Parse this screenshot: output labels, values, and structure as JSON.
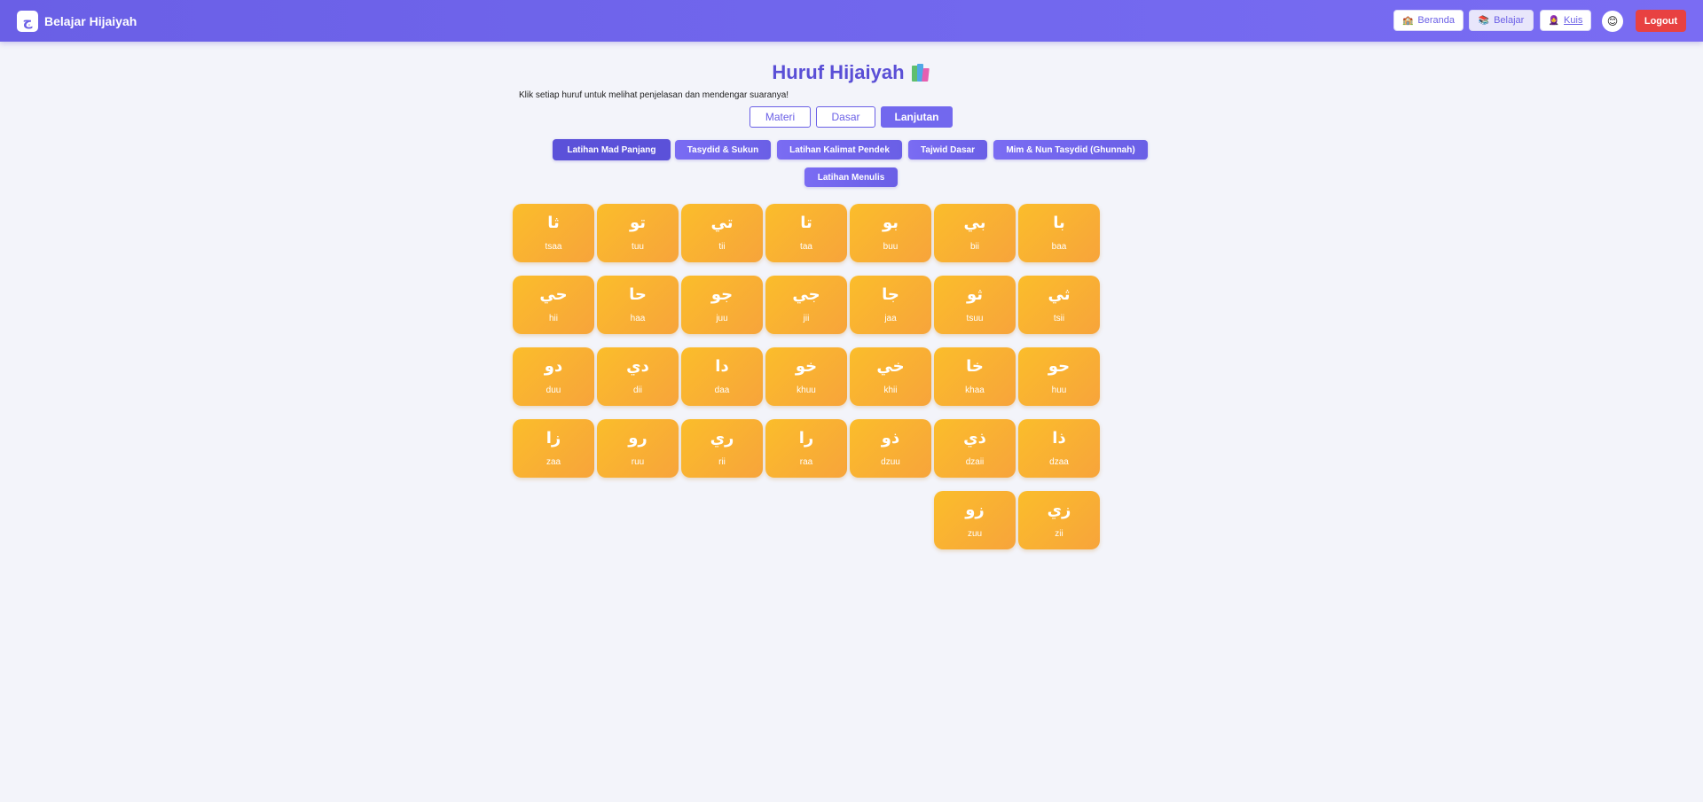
{
  "header": {
    "logo_char": "ج",
    "title": "Belajar Hijaiyah",
    "nav": [
      {
        "icon": "🏫",
        "label": "Beranda"
      },
      {
        "icon": "📚",
        "label": "Belajar"
      },
      {
        "icon": "🧕",
        "label": "Kuis"
      }
    ],
    "avatar": "😊",
    "logout": "Logout"
  },
  "main": {
    "title": "Huruf Hijaiyah",
    "subtitle": "Klik setiap huruf untuk melihat penjelasan dan mendengar suaranya!",
    "tabs": [
      "Materi",
      "Dasar",
      "Lanjutan"
    ],
    "active_tab": "Lanjutan",
    "sub_buttons": [
      "Latihan Mad Panjang",
      "Tasydid & Sukun",
      "Latihan Kalimat Pendek",
      "Tajwid Dasar",
      "Mim & Nun Tasydid (Ghunnah)",
      "Latihan Menulis"
    ],
    "selected_sub": "Latihan Mad Panjang",
    "cards": [
      {
        "ar": "ثا",
        "lat": "tsaa"
      },
      {
        "ar": "تو",
        "lat": "tuu"
      },
      {
        "ar": "تي",
        "lat": "tii"
      },
      {
        "ar": "تا",
        "lat": "taa"
      },
      {
        "ar": "بو",
        "lat": "buu"
      },
      {
        "ar": "بي",
        "lat": "bii"
      },
      {
        "ar": "با",
        "lat": "baa"
      },
      {
        "ar": "حي",
        "lat": "hii"
      },
      {
        "ar": "حا",
        "lat": "haa"
      },
      {
        "ar": "جو",
        "lat": "juu"
      },
      {
        "ar": "جي",
        "lat": "jii"
      },
      {
        "ar": "جا",
        "lat": "jaa"
      },
      {
        "ar": "ثو",
        "lat": "tsuu"
      },
      {
        "ar": "ثي",
        "lat": "tsii"
      },
      {
        "ar": "دو",
        "lat": "duu"
      },
      {
        "ar": "دي",
        "lat": "dii"
      },
      {
        "ar": "دا",
        "lat": "daa"
      },
      {
        "ar": "خو",
        "lat": "khuu"
      },
      {
        "ar": "خي",
        "lat": "khii"
      },
      {
        "ar": "خا",
        "lat": "khaa"
      },
      {
        "ar": "حو",
        "lat": "huu"
      },
      {
        "ar": "زا",
        "lat": "zaa"
      },
      {
        "ar": "رو",
        "lat": "ruu"
      },
      {
        "ar": "ري",
        "lat": "rii"
      },
      {
        "ar": "را",
        "lat": "raa"
      },
      {
        "ar": "ذو",
        "lat": "dzuu"
      },
      {
        "ar": "ذي",
        "lat": "dzaii"
      },
      {
        "ar": "ذا",
        "lat": "dzaa"
      },
      {
        "ar": "زو",
        "lat": "zuu"
      },
      {
        "ar": "زي",
        "lat": "zii"
      }
    ]
  },
  "colors": {
    "primary": "#6a5fe6",
    "card": "#fbbd2b",
    "logout": "#e84141",
    "background": "#f3f4fa"
  }
}
